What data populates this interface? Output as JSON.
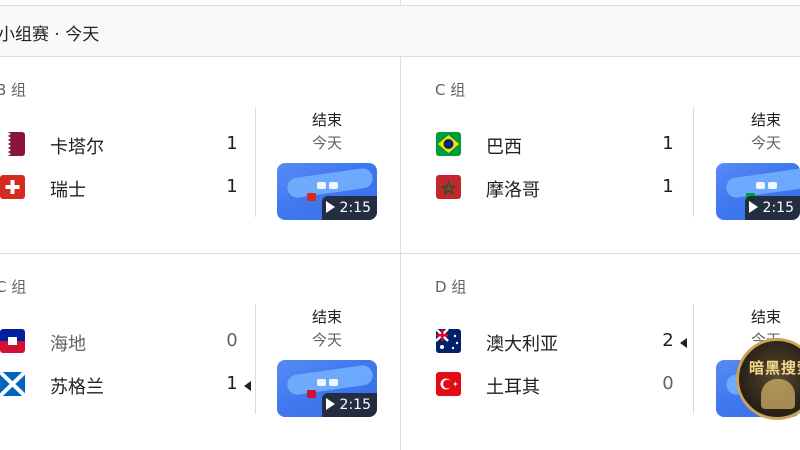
{
  "header": {
    "title": "小组赛 · 今天"
  },
  "matches": [
    {
      "group": "B 组",
      "status": "结束",
      "date": "今天",
      "team1": {
        "name": "卡塔尔",
        "score": "1",
        "flag": "qatar-flag-icon"
      },
      "team2": {
        "name": "瑞士",
        "score": "1",
        "flag": "switzerland-flag-icon"
      },
      "winner": "none",
      "video": {
        "duration": "2:15"
      }
    },
    {
      "group": "C 组",
      "status": "结束",
      "date": "今天",
      "team1": {
        "name": "巴西",
        "score": "1",
        "flag": "brazil-flag-icon"
      },
      "team2": {
        "name": "摩洛哥",
        "score": "1",
        "flag": "morocco-flag-icon"
      },
      "winner": "none",
      "video": {
        "duration": "2:15"
      }
    },
    {
      "group": "C 组",
      "status": "结束",
      "date": "今天",
      "team1": {
        "name": "海地",
        "score": "0",
        "flag": "haiti-flag-icon"
      },
      "team2": {
        "name": "苏格兰",
        "score": "1",
        "flag": "scotland-flag-icon"
      },
      "winner": "team2",
      "video": {
        "duration": "2:15"
      }
    },
    {
      "group": "D 组",
      "status": "结束",
      "date": "今天",
      "team1": {
        "name": "澳大利亚",
        "score": "2",
        "flag": "australia-flag-icon"
      },
      "team2": {
        "name": "土耳其",
        "score": "0",
        "flag": "turkey-flag-icon"
      },
      "winner": "team1",
      "video": {
        "duration": ""
      }
    }
  ],
  "watermark": {
    "text": "暗黑搜索"
  },
  "colors": {
    "accent_blue": "#3f78ef",
    "divider": "#dadce0",
    "header_bg": "#f8f9fa"
  }
}
